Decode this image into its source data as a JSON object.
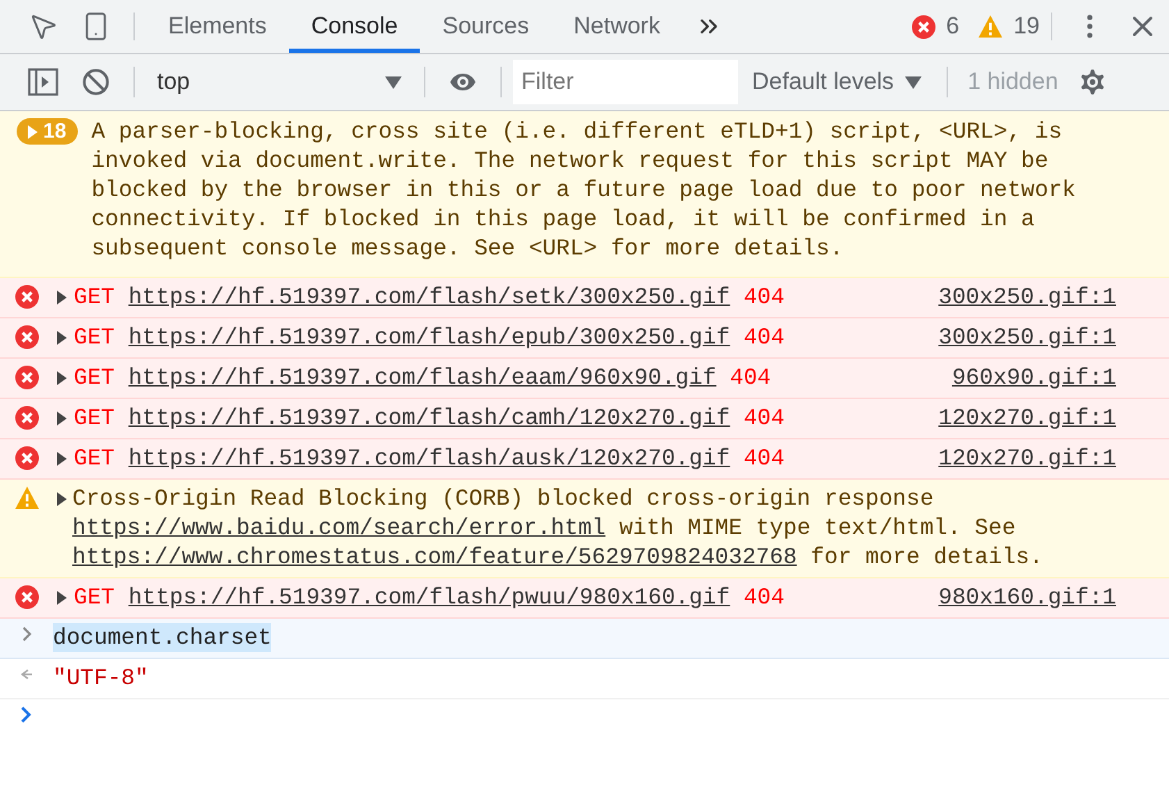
{
  "toolbar": {
    "tabs": [
      {
        "label": "Elements",
        "selected": false
      },
      {
        "label": "Console",
        "selected": true
      },
      {
        "label": "Sources",
        "selected": false
      },
      {
        "label": "Network",
        "selected": false
      }
    ],
    "error_count": "6",
    "warning_count": "19"
  },
  "console_bar": {
    "context": "top",
    "filter_placeholder": "Filter",
    "levels": "Default levels",
    "hidden": "1 hidden"
  },
  "messages": [
    {
      "kind": "warning-group",
      "count": "18",
      "text": "A parser-blocking, cross site (i.e. different eTLD+1) script, <URL>, is invoked via document.write. The network request for this script MAY be blocked by the browser in this or a future page load due to poor network connectivity. If blocked in this page load, it will be confirmed in a subsequent console message. See <URL> for more details."
    },
    {
      "kind": "error",
      "method": "GET",
      "url": "https://hf.519397.com/flash/setk/300x250.gif",
      "status": "404",
      "source": "300x250.gif:1"
    },
    {
      "kind": "error",
      "method": "GET",
      "url": "https://hf.519397.com/flash/epub/300x250.gif",
      "status": "404",
      "source": "300x250.gif:1"
    },
    {
      "kind": "error",
      "method": "GET",
      "url": "https://hf.519397.com/flash/eaam/960x90.gif",
      "status": "404",
      "source": "960x90.gif:1"
    },
    {
      "kind": "error",
      "method": "GET",
      "url": "https://hf.519397.com/flash/camh/120x270.gif",
      "status": "404",
      "source": "120x270.gif:1"
    },
    {
      "kind": "error",
      "method": "GET",
      "url": "https://hf.519397.com/flash/ausk/120x270.gif",
      "status": "404",
      "source": "120x270.gif:1"
    },
    {
      "kind": "warning",
      "parts": [
        {
          "text": "Cross-Origin Read Blocking (CORB) blocked cross-origin response ",
          "link": false
        },
        {
          "text": "https://www.baidu.com/search/error.html",
          "link": true
        },
        {
          "text": " with MIME type text/html. See ",
          "link": false
        },
        {
          "text": "https://www.chromestatus.com/feature/5629709824032768",
          "link": true
        },
        {
          "text": " for more details.",
          "link": false
        }
      ]
    },
    {
      "kind": "error",
      "method": "GET",
      "url": "https://hf.519397.com/flash/pwuu/980x160.gif",
      "status": "404",
      "source": "980x160.gif:1"
    },
    {
      "kind": "input",
      "text": "document.charset",
      "highlighted": true
    },
    {
      "kind": "result",
      "text": "\"UTF-8\""
    },
    {
      "kind": "prompt"
    }
  ]
}
